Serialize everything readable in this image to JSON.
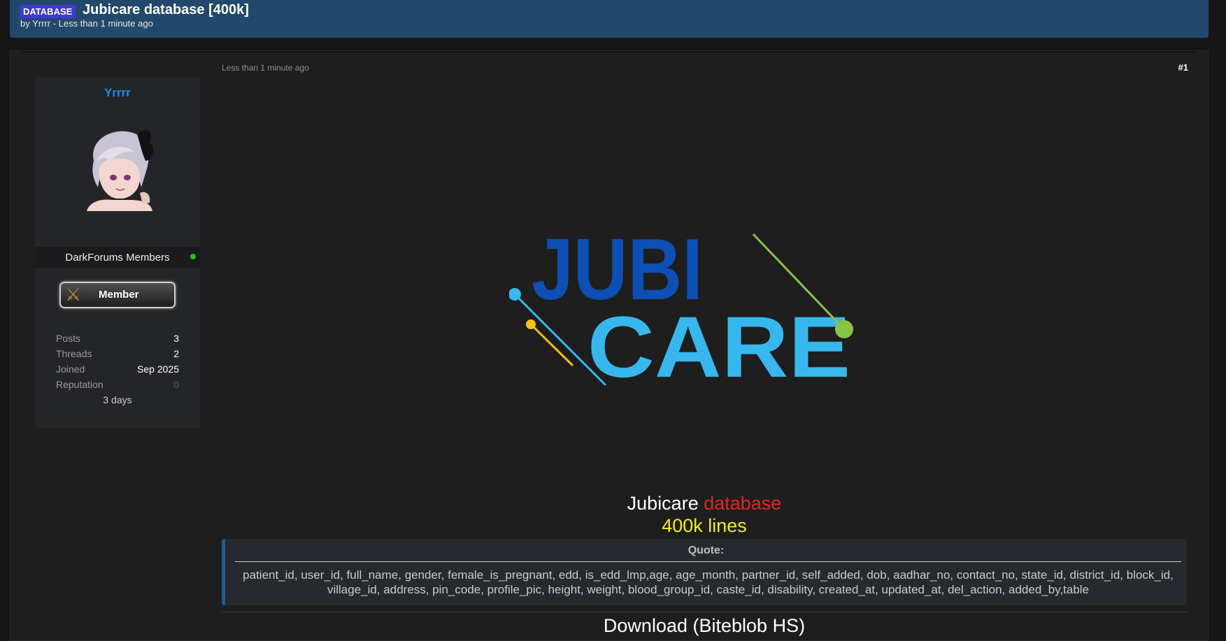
{
  "thread": {
    "prefix": "DATABASE",
    "title": "Jubicare database [400k]",
    "byline": "by Yrrrr - Less than 1 minute ago"
  },
  "post": {
    "time": "Less than 1 minute ago",
    "number": "#1"
  },
  "author": {
    "name": "Yrrrr",
    "group": "DarkForums Members",
    "badge": "Member",
    "stats": [
      {
        "label": "Posts",
        "value": "3"
      },
      {
        "label": "Threads",
        "value": "2"
      },
      {
        "label": "Joined",
        "value": "Sep 2025"
      },
      {
        "label": "Reputation",
        "value": "0"
      }
    ],
    "footer": "3 days"
  },
  "logo": {
    "line1": "JUBI",
    "line2": "CARE"
  },
  "content": {
    "title_part1": "Jubicare ",
    "title_part2": "database",
    "subtitle": "400k lines",
    "quote_label": "Quote:",
    "quote_text": "patient_id, user_id, full_name, gender, female_is_pregnant, edd, is_edd_lmp,age, age_month, partner_id, self_added, dob, aadhar_no, contact_no, state_id, district_id, block_id, village_id, address, pin_code, profile_pic, height, weight, blood_group_id, caste_id, disability, created_at, updated_at, del_action, added_by,table",
    "download": "Download (Biteblob HS)"
  },
  "colors": {
    "header_bg": "#22496b",
    "prefix_bg": "#3f3ad0",
    "username": "#1c8cf0",
    "online": "#1fc31f",
    "logo_dark_blue": "#0d4fb5",
    "logo_light_blue": "#38b7ee",
    "logo_yellow": "#f2c21a",
    "logo_green": "#8ac34a",
    "red_text": "#e22525",
    "yellow_text": "#f2ee16"
  }
}
